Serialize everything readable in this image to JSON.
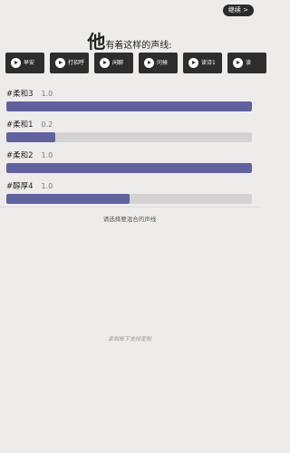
{
  "header": {
    "continue_label": "继续 >"
  },
  "title": {
    "subject": "他",
    "suffix": "有着这样的声线:"
  },
  "chips": [
    {
      "label": "早安",
      "icon": "play-icon"
    },
    {
      "label": "打招呼",
      "icon": "play-icon"
    },
    {
      "label": "闲聊",
      "icon": "play-icon"
    },
    {
      "label": "问候",
      "icon": "play-icon"
    },
    {
      "label": "读诗1",
      "icon": "play-icon"
    },
    {
      "label": "读",
      "icon": "play-icon"
    }
  ],
  "mixes": [
    {
      "name": "#柔和3",
      "value": "1.0",
      "level": 1.0
    },
    {
      "name": "#柔和1",
      "value": "0.2",
      "level": 0.2
    },
    {
      "name": "#柔和2",
      "value": "1.0",
      "level": 1.0
    },
    {
      "name": "#醇厚4",
      "value": "1.0",
      "level": 0.5
    }
  ],
  "hint": "请选择要混合的声线",
  "footer_note": "拿到账下支持定制",
  "colors": {
    "background": "#eeeceb",
    "chip": "#2d2d2d",
    "bar_fill": "#6261a0",
    "bar_track": "#d4d2d2"
  }
}
